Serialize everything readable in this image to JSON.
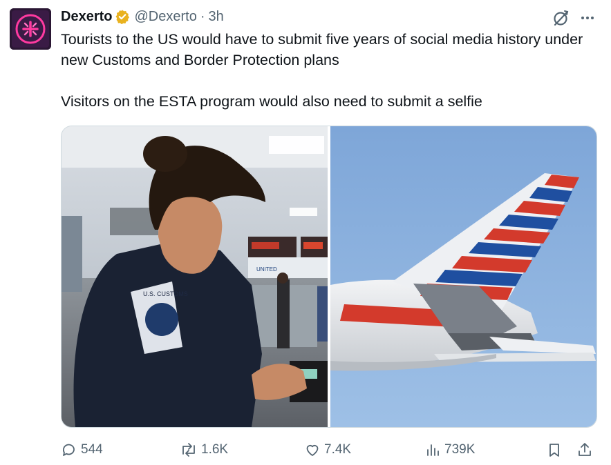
{
  "tweet": {
    "author_name": "Dexerto",
    "handle": "@Dexerto",
    "separator": "·",
    "time": "3h",
    "text_line1": "Tourists to the US would have to submit five years of social media history under new Customs and Border Protection plans",
    "text_line2": "Visitors on the ESTA program would also need to submit a selfie"
  },
  "media": {
    "left_image": "border-officer-photo",
    "right_image": "airplane-tail-photo"
  },
  "actions": {
    "replies": "544",
    "reposts": "1.6K",
    "likes": "7.4K",
    "views": "739K"
  },
  "colors": {
    "text_primary": "#0f1419",
    "text_secondary": "#536471",
    "verified_badge": "#e9b21f",
    "avatar_bg": "#2a1633",
    "avatar_accent": "#ff3aa0"
  },
  "icons": [
    "verified-badge-icon",
    "grok-icon",
    "more-icon",
    "reply-icon",
    "repost-icon",
    "like-icon",
    "views-icon",
    "bookmark-icon",
    "share-icon"
  ]
}
